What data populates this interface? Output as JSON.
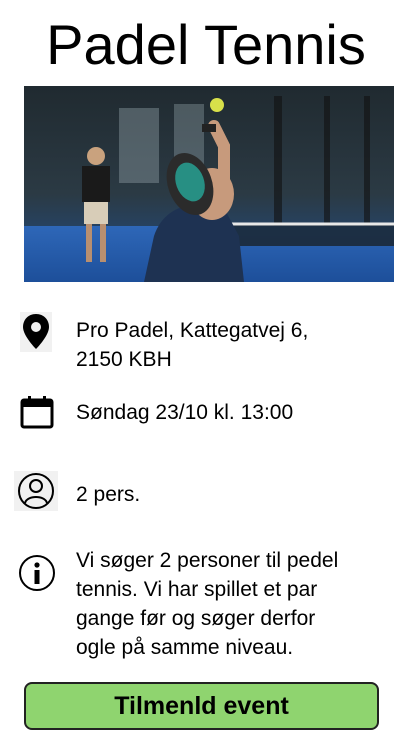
{
  "page": {
    "title": "Padel Tennis"
  },
  "hero_image": {
    "subject": "padel player serving on blue court"
  },
  "details": {
    "location": {
      "icon": "map-pin-icon",
      "line1": "Pro Padel, Kattegatvej 6,",
      "line2": "2150 KBH"
    },
    "date": {
      "icon": "calendar-icon",
      "text": "Søndag 23/10 kl. 13:00"
    },
    "people": {
      "icon": "user-circle-icon",
      "text": "2 pers."
    },
    "info": {
      "icon": "info-icon",
      "lines": [
        "Vi søger 2 personer til pedel",
        "tennis. Vi har spillet et par",
        "gange før og søger derfor",
        "ogle på samme niveau."
      ]
    }
  },
  "action": {
    "signup_label": "Tilmenld event",
    "button_color": "#8fd46f"
  }
}
